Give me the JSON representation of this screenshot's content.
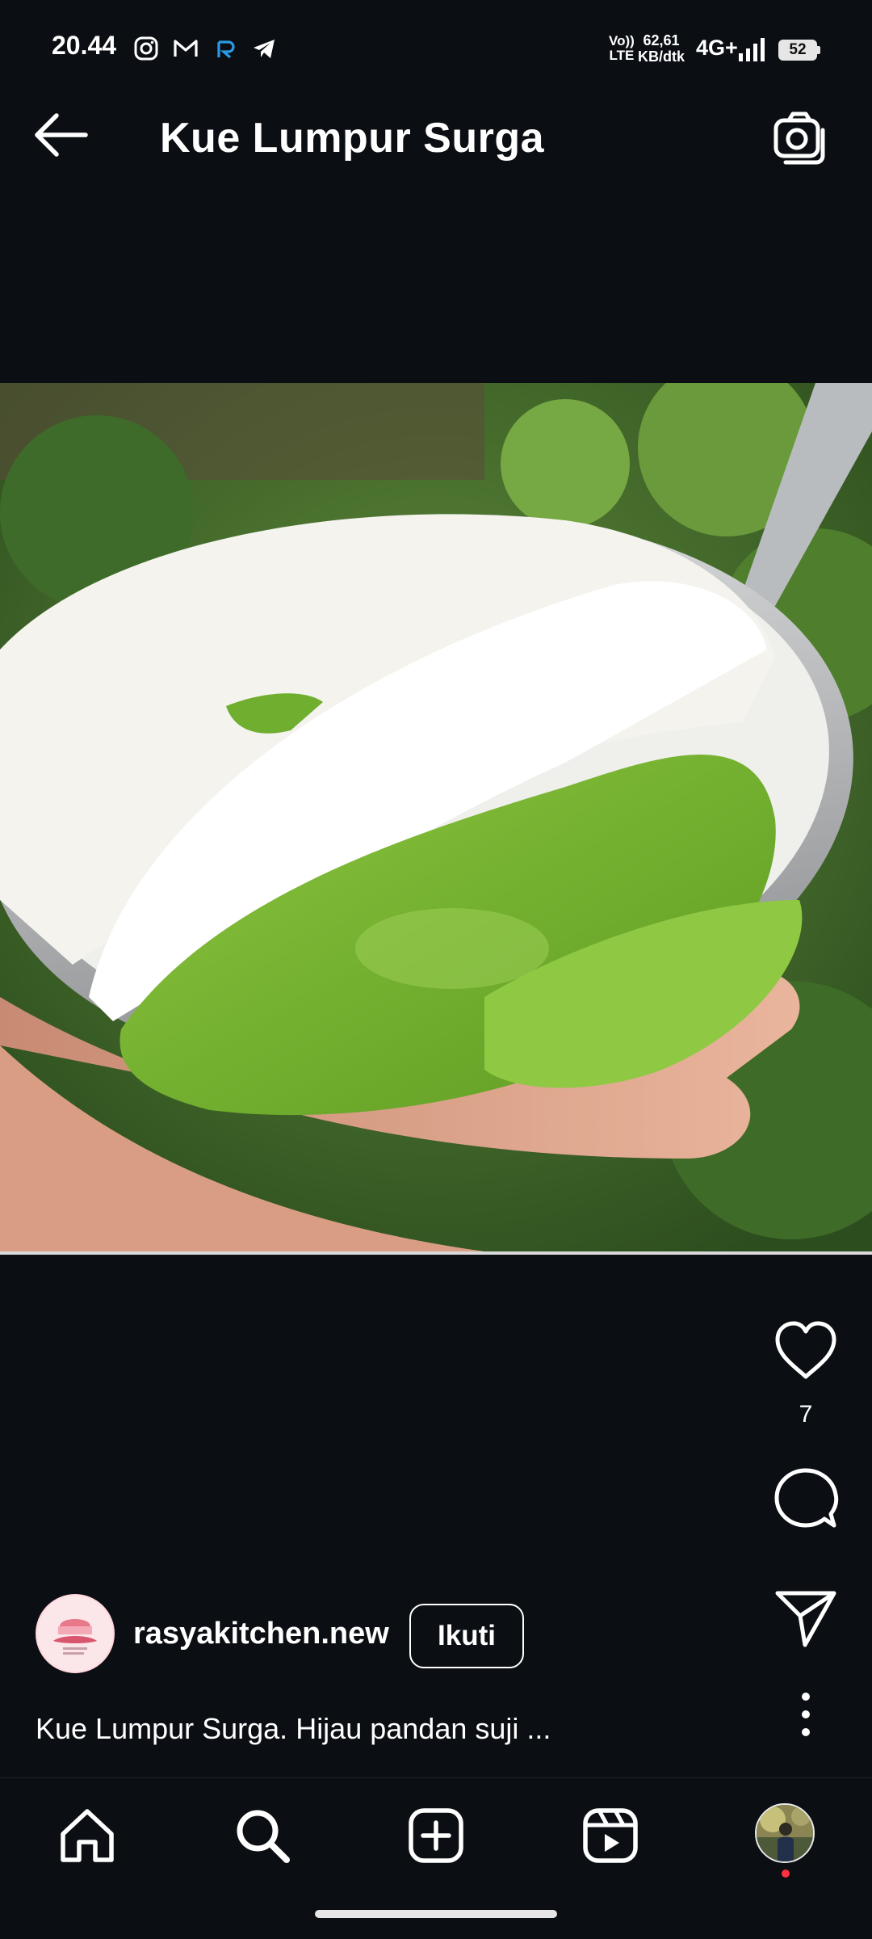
{
  "status_bar": {
    "time": "20.44",
    "net_line1": "Vo))",
    "net_line2": "LTE",
    "speed_line1": "62,61",
    "speed_line2": "KB/dtk",
    "network": "4G+",
    "battery": "52",
    "app_icons": [
      "instagram-icon",
      "gmail-icon",
      "r-app-icon",
      "telegram-icon"
    ]
  },
  "header": {
    "title": "Kue Lumpur Surga"
  },
  "post": {
    "like_count": "7",
    "username": "rasyakitchen.new",
    "follow_label": "Ikuti",
    "caption": "Kue Lumpur Surga. Hijau pandan suji ...",
    "avatar_text": "Rasya Kitchen"
  },
  "nav": {
    "items": [
      "home-icon",
      "search-icon",
      "create-icon",
      "reels-icon",
      "profile-avatar"
    ],
    "active": "search"
  },
  "colors": {
    "background": "#0b0e13",
    "text": "#ffffff",
    "notification_dot": "#ff3040"
  }
}
